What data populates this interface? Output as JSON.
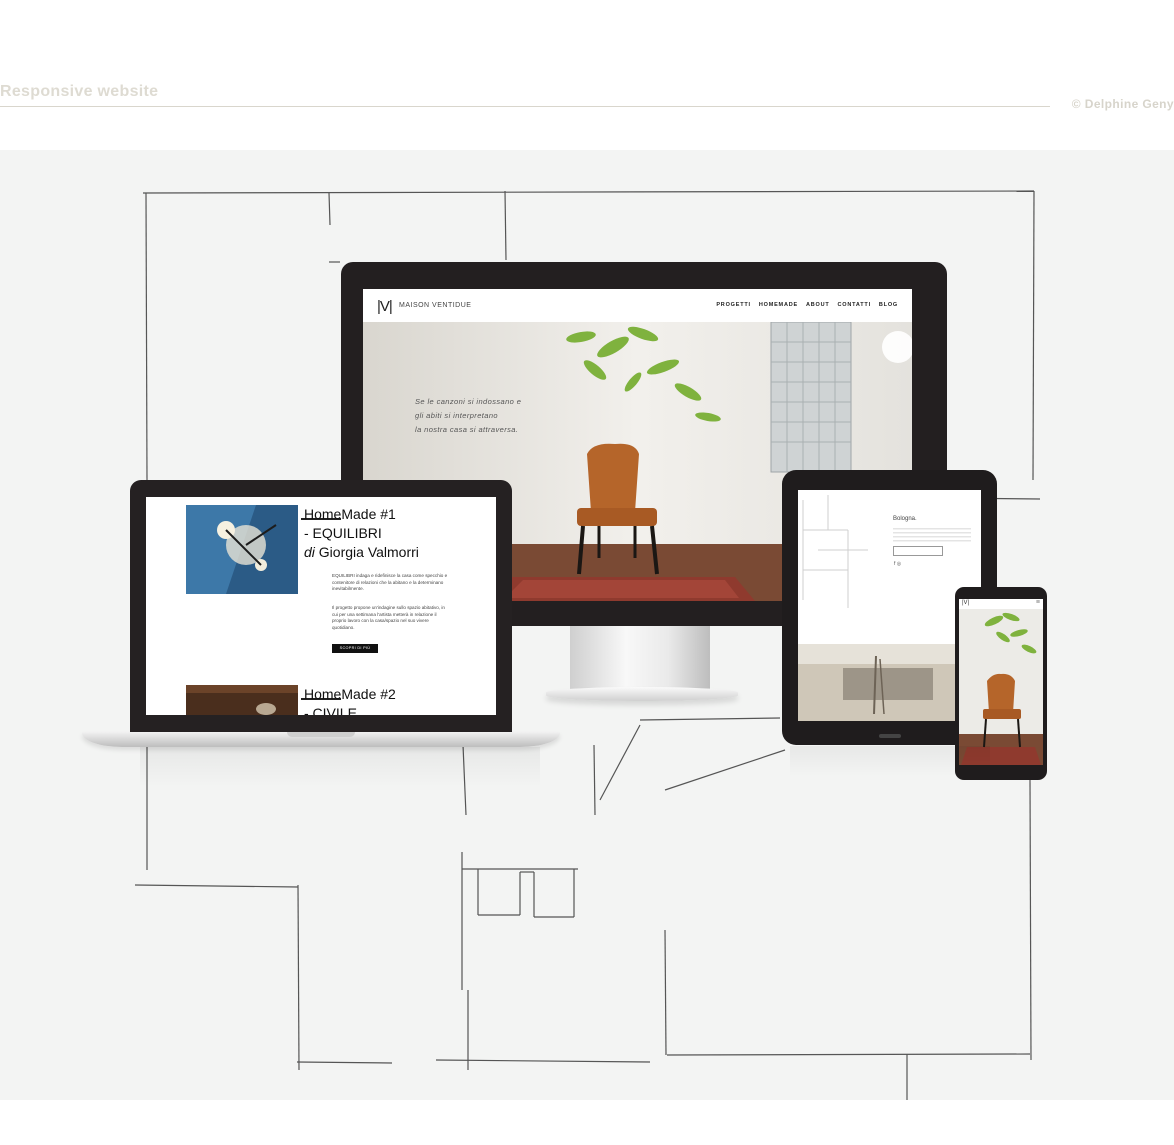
{
  "header": {
    "title": "Responsive website",
    "credit": "© Delphine Geny"
  },
  "site": {
    "logo": "|V|",
    "brand": "MAISON VENTIDUE",
    "menu": [
      "PROGETTI",
      "HOMEMADE",
      "ABOUT",
      "CONTATTI",
      "BLOG"
    ],
    "quote_lines": [
      "Se le canzoni si indossano e",
      "gli abiti si interpretano",
      "la nostra casa si attraversa."
    ]
  },
  "laptop_page": {
    "post1_title_lines": [
      "HomeMade #1",
      "- EQUILIBRI"
    ],
    "post1_author_prefix": "di",
    "post1_author": "Giorgia Valmorri",
    "post1_body_lines": [
      "EQUILIBRI indaga e ridefinisce la casa come specchio e",
      "contenitore di relazioni che la abitano e la determinano",
      "inevitabilmente."
    ],
    "post1_body2_lines": [
      "Il progetto propone un'indagine sullo spazio abitativo, in",
      "cui per una settimana l'artista metterà in relazione il",
      "proprio lavoro con la casa/spazio nel suo vivere",
      "quotidiano."
    ],
    "button": "SCOPRI DI PIÙ",
    "post2_title_lines": [
      "HomeMade #2",
      "- CIVILE"
    ]
  },
  "tablet_page": {
    "city": "Bologna."
  },
  "colors": {
    "device_frame": "#231f20",
    "stage_bg": "#f3f4f3",
    "header_text": "#dedbd2",
    "chair": "#b5652a",
    "rug": "#8f3a2e"
  }
}
